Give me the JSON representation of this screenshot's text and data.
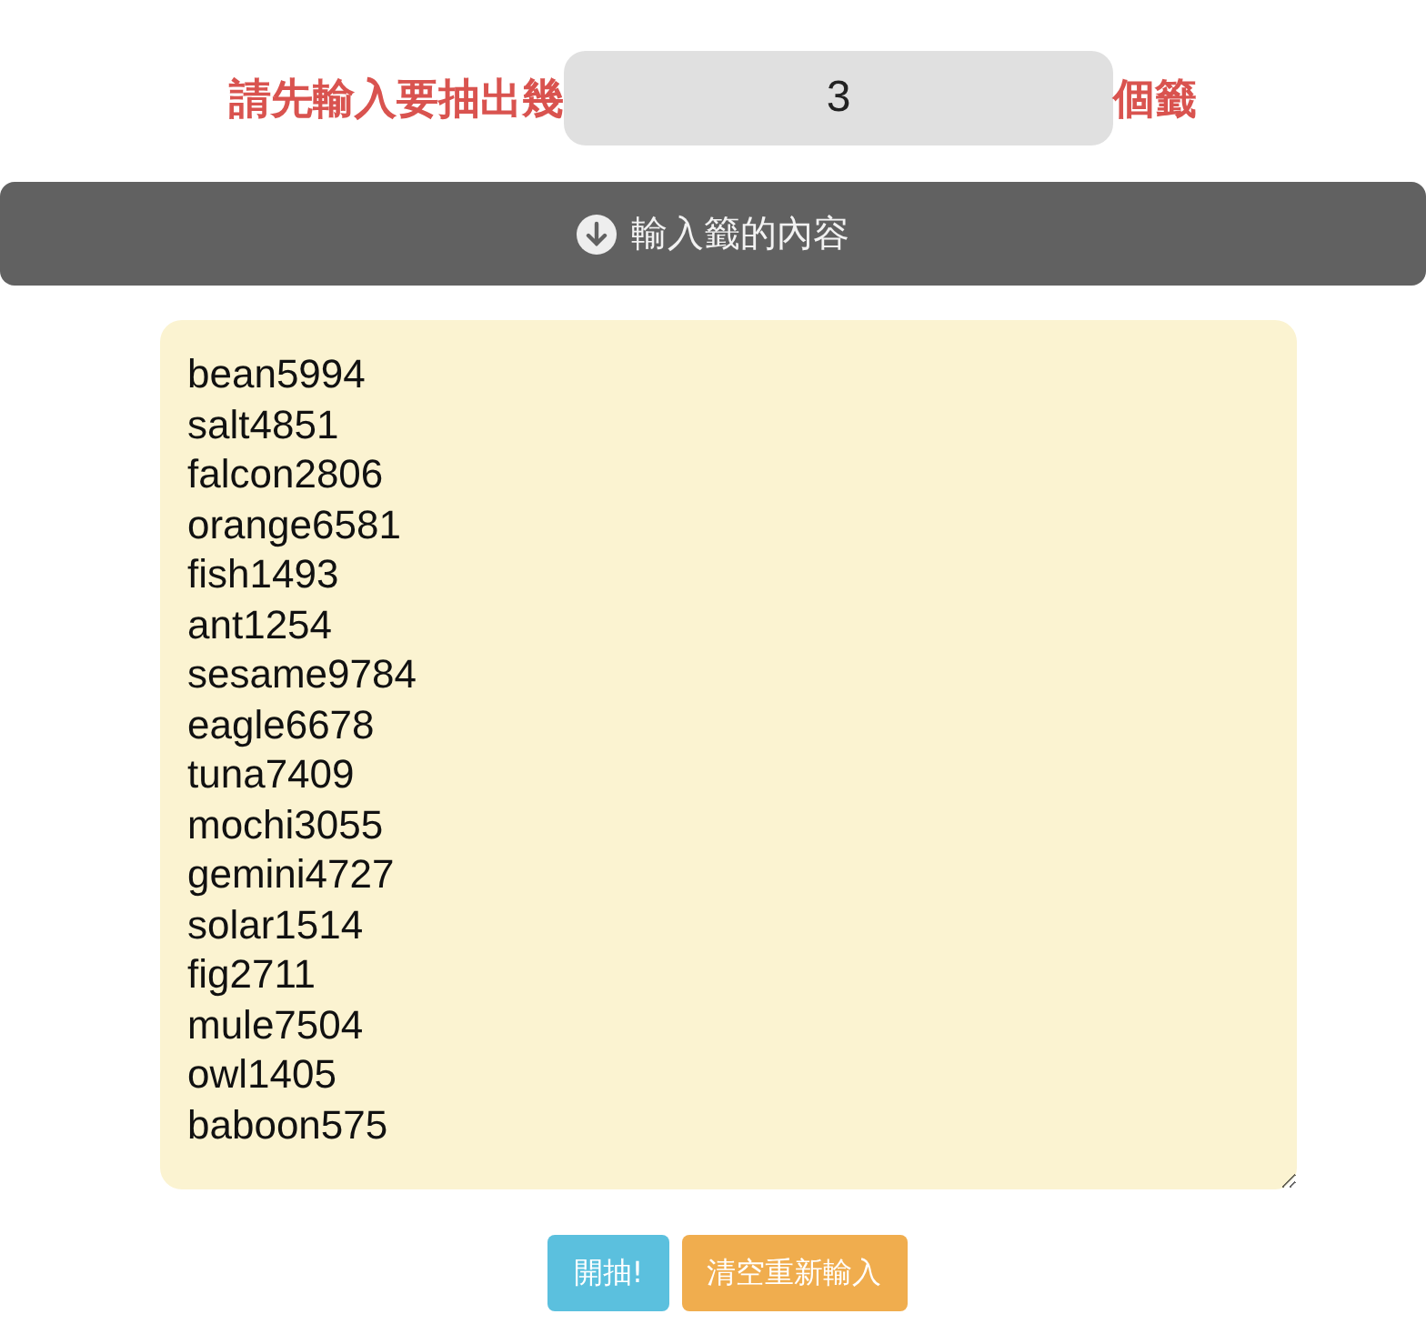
{
  "count_prompt": {
    "before": "請先輸入要抽出幾",
    "value": "3",
    "after": "個籤"
  },
  "section_bar": {
    "label": "輸入籤的內容"
  },
  "entries": [
    "bean5994",
    "salt4851",
    "falcon2806",
    "orange6581",
    "fish1493",
    "ant1254",
    "sesame9784",
    "eagle6678",
    "tuna7409",
    "mochi3055",
    "gemini4727",
    "solar1514",
    "fig2711",
    "mule7504",
    "owl1405",
    "baboon575"
  ],
  "buttons": [
    {
      "label": "開抽!",
      "kind": "primary"
    },
    {
      "label": "清空重新輸入",
      "kind": "warning"
    }
  ]
}
